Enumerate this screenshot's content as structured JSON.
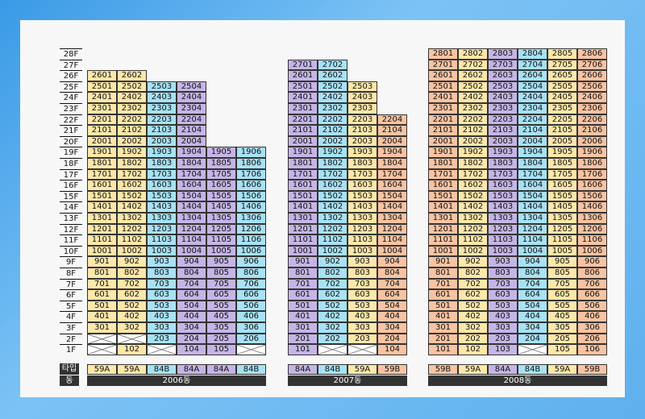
{
  "floors": [
    "28F",
    "27F",
    "26F",
    "25F",
    "24F",
    "23F",
    "22F",
    "21F",
    "20F",
    "19F",
    "18F",
    "17F",
    "16F",
    "15F",
    "14F",
    "13F",
    "12F",
    "11F",
    "10F",
    "9F",
    "8F",
    "7F",
    "6F",
    "5F",
    "4F",
    "3F",
    "2F",
    "1F"
  ],
  "legend": {
    "type_label": "타입",
    "dong_label": "동"
  },
  "buildings": [
    {
      "name": "2006동",
      "columns": [
        {
          "line": "01",
          "type": "59A",
          "color": "y",
          "top_floor": 26,
          "empty_floors": [
            1,
            2
          ]
        },
        {
          "line": "02",
          "type": "59A",
          "color": "y",
          "top_floor": 26,
          "empty_floors": [
            2
          ]
        },
        {
          "line": "03",
          "type": "84B",
          "color": "b",
          "top_floor": 25,
          "empty_floors": [
            1
          ]
        },
        {
          "line": "04",
          "type": "84A",
          "color": "p",
          "top_floor": 25,
          "empty_floors": []
        },
        {
          "line": "05",
          "type": "84A",
          "color": "p",
          "top_floor": 19,
          "empty_floors": []
        },
        {
          "line": "06",
          "type": "84B",
          "color": "b",
          "top_floor": 19,
          "empty_floors": [
            1
          ]
        }
      ]
    },
    {
      "name": "2007동",
      "columns": [
        {
          "line": "01",
          "type": "84A",
          "color": "p",
          "top_floor": 27,
          "empty_floors": []
        },
        {
          "line": "02",
          "type": "84B",
          "color": "b",
          "top_floor": 27,
          "empty_floors": [
            1
          ]
        },
        {
          "line": "03",
          "type": "59A",
          "color": "y",
          "top_floor": 25,
          "empty_floors": [
            1
          ]
        },
        {
          "line": "04",
          "type": "59B",
          "color": "o",
          "top_floor": 22,
          "empty_floors": []
        }
      ]
    },
    {
      "name": "2008동",
      "columns": [
        {
          "line": "01",
          "type": "59B",
          "color": "o",
          "top_floor": 28,
          "empty_floors": []
        },
        {
          "line": "02",
          "type": "59A",
          "color": "y",
          "top_floor": 28,
          "empty_floors": []
        },
        {
          "line": "03",
          "type": "84A",
          "color": "p",
          "top_floor": 28,
          "empty_floors": []
        },
        {
          "line": "04",
          "type": "84B",
          "color": "b",
          "top_floor": 28,
          "empty_floors": [
            1
          ]
        },
        {
          "line": "05",
          "type": "59A",
          "color": "y",
          "top_floor": 28,
          "empty_floors": []
        },
        {
          "line": "06",
          "type": "59B",
          "color": "o",
          "top_floor": 28,
          "empty_floors": []
        }
      ]
    }
  ]
}
